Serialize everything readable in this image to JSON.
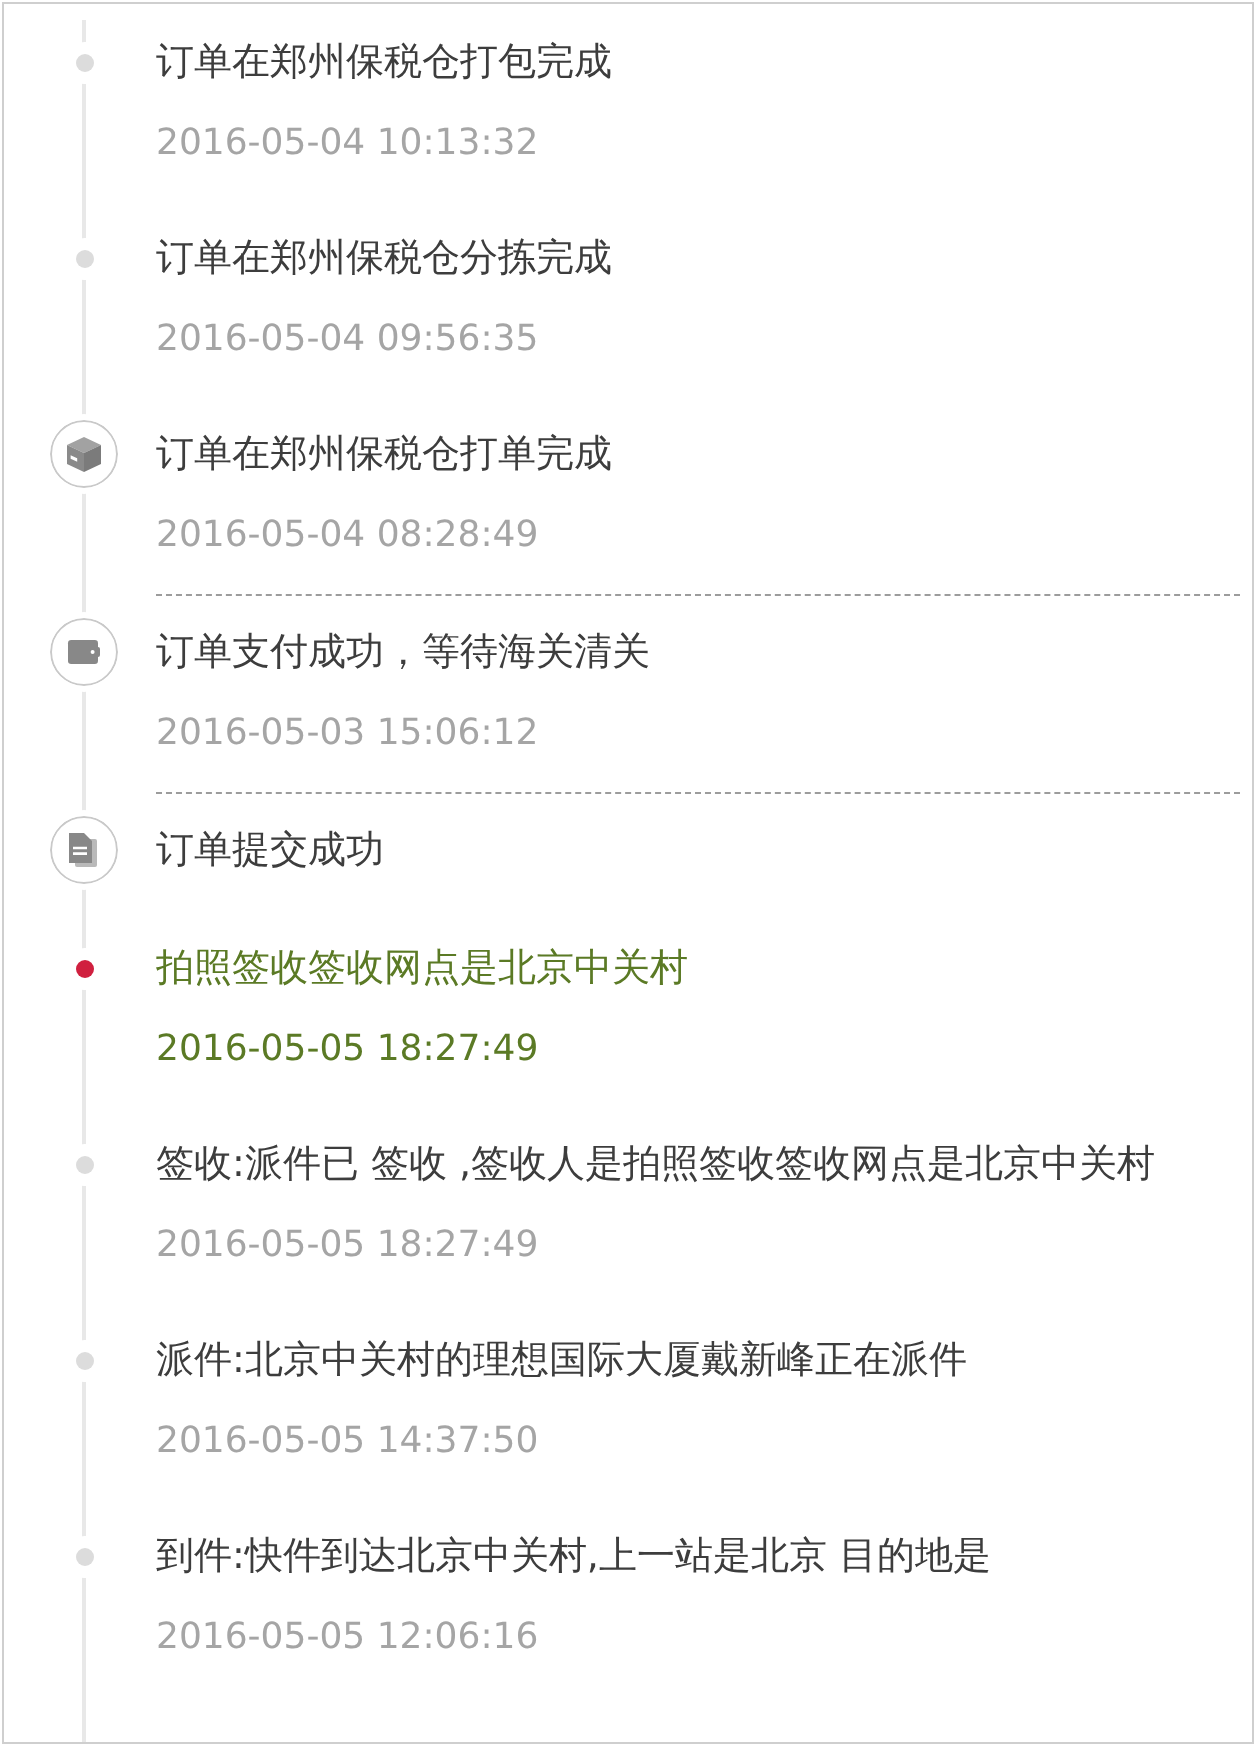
{
  "timeline": {
    "events": [
      {
        "kind": "dot",
        "title": "订单在郑州保税仓打包完成",
        "time": "2016-05-04 10:13:32",
        "current": false,
        "divider": false
      },
      {
        "kind": "dot",
        "title": "订单在郑州保税仓分拣完成",
        "time": "2016-05-04 09:56:35",
        "current": false,
        "divider": false
      },
      {
        "kind": "package",
        "title": "订单在郑州保税仓打单完成",
        "time": "2016-05-04 08:28:49",
        "current": false,
        "divider": false
      },
      {
        "kind": "wallet",
        "title": "订单支付成功，等待海关清关",
        "time": "2016-05-03 15:06:12",
        "current": false,
        "divider": true
      },
      {
        "kind": "document",
        "title": "订单提交成功",
        "current": false,
        "divider": true
      },
      {
        "kind": "dot",
        "title": "拍照签收签收网点是北京中关村",
        "time": "2016-05-05 18:27:49",
        "current": true,
        "divider": false
      },
      {
        "kind": "dot",
        "title": "签收:派件已 签收 ,签收人是拍照签收签收网点是北京中关村",
        "time": "2016-05-05 18:27:49",
        "current": false,
        "divider": false
      },
      {
        "kind": "dot",
        "title": "派件:北京中关村的理想国际大厦戴新峰正在派件",
        "time": "2016-05-05 14:37:50",
        "current": false,
        "divider": false
      },
      {
        "kind": "dot",
        "title": "到件:快件到达北京中关村,上一站是北京 目的地是",
        "time": "2016-05-05 12:06:16",
        "current": false,
        "divider": false
      }
    ]
  }
}
